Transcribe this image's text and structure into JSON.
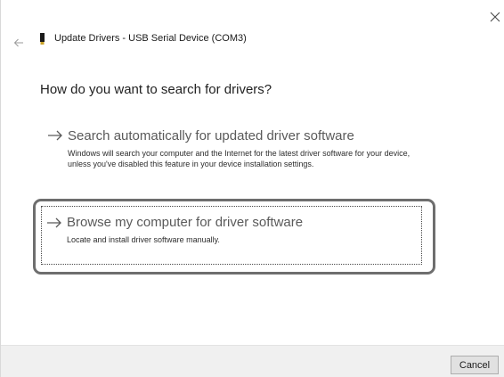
{
  "window": {
    "title": "Update Drivers - USB Serial Device (COM3)"
  },
  "icons": {
    "close": "close-icon",
    "back": "back-arrow-icon",
    "device": "usb-device-icon",
    "option_arrow": "right-arrow-icon"
  },
  "main": {
    "heading": "How do you want to search for drivers?",
    "options": [
      {
        "title": "Search automatically for updated driver software",
        "description": "Windows will search your computer and the Internet for the latest driver software for your device, unless you've disabled this feature in your device installation settings."
      },
      {
        "title": "Browse my computer for driver software",
        "description": "Locate and install driver software manually.",
        "highlighted": true
      }
    ]
  },
  "footer": {
    "cancel_label": "Cancel"
  },
  "colors": {
    "highlight_ring": "#6e6e6e",
    "option_title": "#5a5a5a",
    "footer_bg": "#f0f0f0"
  }
}
